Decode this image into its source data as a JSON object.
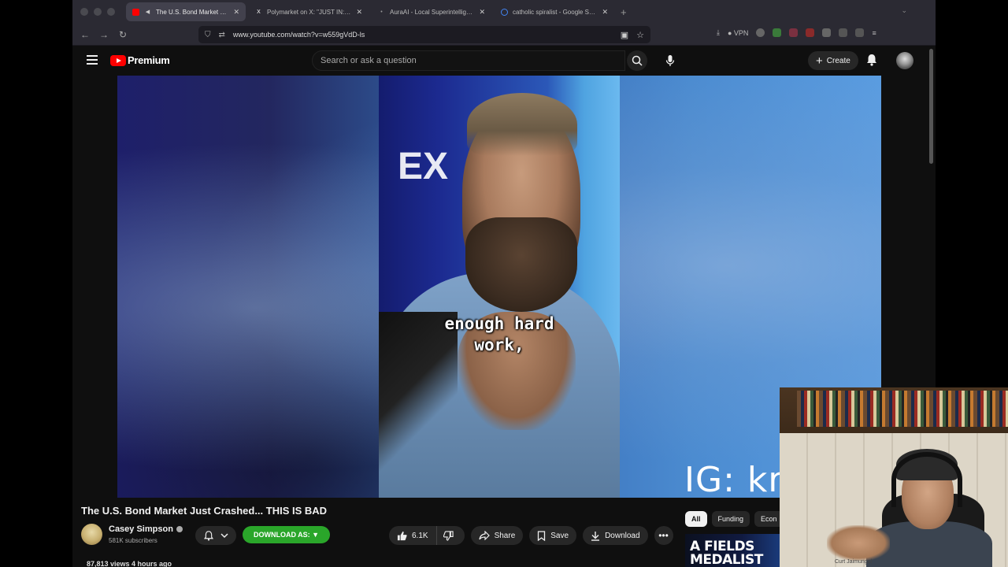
{
  "browser": {
    "tabs": [
      {
        "title": "The U.S. Bond Market Just Crashed",
        "active": true,
        "favicon_color": "#ff0000"
      },
      {
        "title": "Polymarket on X: \"JUST IN: It's",
        "active": false,
        "favicon_color": "#ffffff"
      },
      {
        "title": "AuraAI - Local Superintelligence",
        "active": false,
        "favicon_color": "#888888"
      },
      {
        "title": "catholic spiralist - Google Search",
        "active": false,
        "favicon_color": "#4285f4"
      }
    ],
    "url": "www.youtube.com/watch?v=w559gVdD-ls",
    "vpn_label": "VPN"
  },
  "youtube": {
    "logo_text": "Premium",
    "search_placeholder": "Search or ask a question",
    "create_label": "Create"
  },
  "video": {
    "caption_line1": "enough hard",
    "caption_line2": "work,",
    "background_text": "EX",
    "overlay_text": "IG: krisk"
  },
  "details": {
    "title": "The U.S. Bond Market Just Crashed... THIS IS BAD",
    "channel_name": "Casey Simpson",
    "subscribers": "581K subscribers",
    "download_as_label": "DOWNLOAD AS: ▼",
    "likes": "6.1K",
    "share_label": "Share",
    "save_label": "Save",
    "download_label": "Download",
    "views_line": "87,813 views  4 hours ago"
  },
  "sidebar": {
    "chips": [
      "All",
      "Funding",
      "Econ"
    ],
    "thumb_text": "A FIELDS MEDALIST"
  },
  "webcam": {
    "label": "Curt Jaimungal"
  }
}
